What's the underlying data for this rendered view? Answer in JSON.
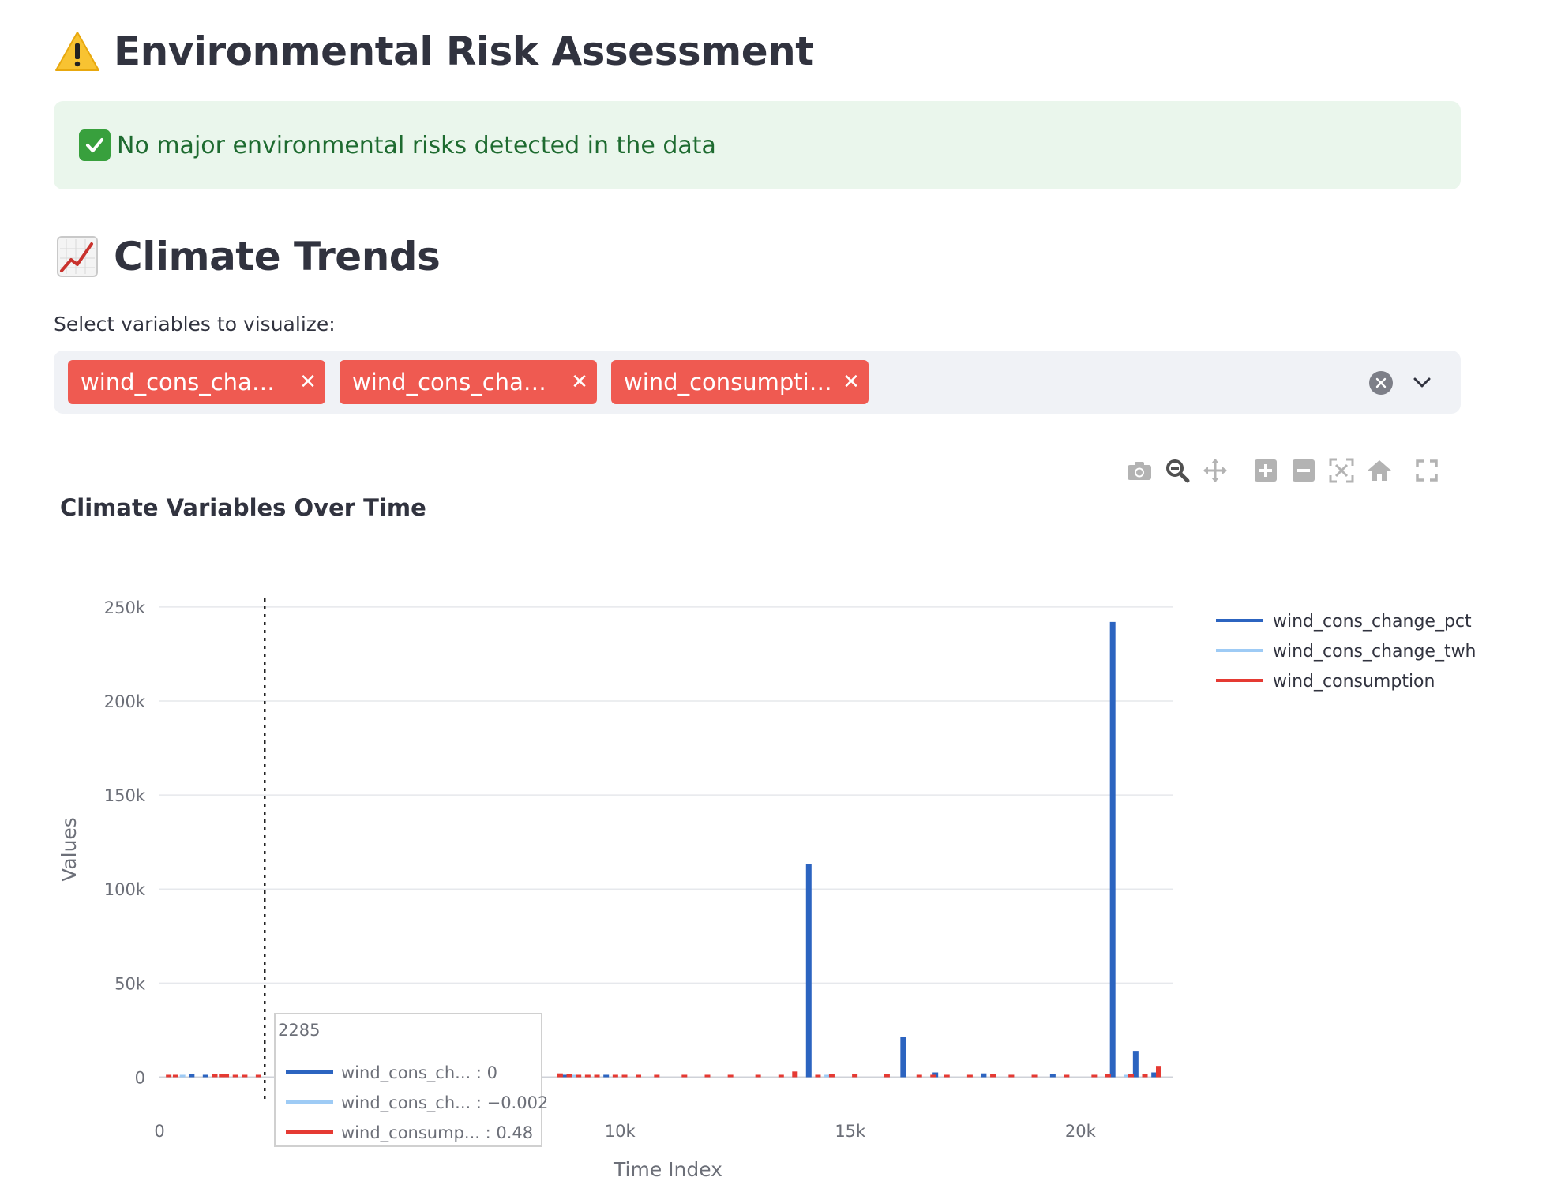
{
  "risk": {
    "heading": "Environmental Risk Assessment",
    "heading_icon": "warning-icon",
    "alert_icon": "check-icon",
    "alert_text": "No major environmental risks detected in the data",
    "alert_color": "#eaf6ec"
  },
  "trends": {
    "heading": "Climate Trends",
    "heading_icon": "chart-increasing-icon",
    "select_label": "Select variables to visualize:",
    "selected": [
      "wind_cons_cha…",
      "wind_cons_cha…",
      "wind_consumpti…"
    ],
    "tag_color": "#ef5a51"
  },
  "modebar": [
    "camera-icon",
    "zoom-icon",
    "pan-icon",
    "zoom-in-icon",
    "zoom-out-icon",
    "autoscale-icon",
    "reset-axes-icon",
    "fullscreen-icon"
  ],
  "hover": {
    "x": "2285",
    "rows": [
      {
        "label": "wind_cons_ch... : 0",
        "color": "#2c64c0"
      },
      {
        "label": "wind_cons_ch... : −0.002",
        "color": "#9ecbf5"
      },
      {
        "label": "wind_consump... : 0.48",
        "color": "#e53a33"
      }
    ]
  },
  "chart_data": {
    "type": "bar",
    "title": "Climate Variables Over Time",
    "xlabel": "Time Index",
    "ylabel": "Values",
    "xlim": [
      0,
      22000
    ],
    "ylim": [
      -4000,
      260000
    ],
    "xticks": [
      0,
      10000,
      15000,
      20000
    ],
    "xtick_labels": [
      "0",
      "10k",
      "15k",
      "20k"
    ],
    "yticks": [
      0,
      50000,
      100000,
      150000,
      200000,
      250000
    ],
    "ytick_labels": [
      "0",
      "50k",
      "100k",
      "150k",
      "200k",
      "250k"
    ],
    "grid": true,
    "legend_position": "top-right",
    "hover_x": 2285,
    "series": [
      {
        "name": "wind_cons_change_pct",
        "color": "#2c64c0",
        "points": [
          [
            700,
            1500
          ],
          [
            1000,
            1200
          ],
          [
            8800,
            1000
          ],
          [
            9700,
            700
          ],
          [
            14100,
            113500
          ],
          [
            16150,
            21500
          ],
          [
            16850,
            2500
          ],
          [
            17900,
            2000
          ],
          [
            19400,
            1500
          ],
          [
            20700,
            242000
          ],
          [
            21200,
            14000
          ],
          [
            21600,
            2500
          ]
        ]
      },
      {
        "name": "wind_cons_change_twh",
        "color": "#9ecbf5",
        "points": [
          [
            500,
            200
          ],
          [
            9000,
            200
          ],
          [
            14500,
            200
          ],
          [
            18500,
            200
          ],
          [
            21000,
            200
          ]
        ]
      },
      {
        "name": "wind_consumption",
        "color": "#e53a33",
        "points": [
          [
            200,
            1000
          ],
          [
            350,
            1000
          ],
          [
            1200,
            1500
          ],
          [
            1350,
            1800
          ],
          [
            1450,
            1700
          ],
          [
            1650,
            900
          ],
          [
            1850,
            700
          ],
          [
            2150,
            500
          ],
          [
            8700,
            2000
          ],
          [
            8900,
            1500
          ],
          [
            9100,
            1000
          ],
          [
            9300,
            800
          ],
          [
            9500,
            700
          ],
          [
            9900,
            900
          ],
          [
            10100,
            900
          ],
          [
            10400,
            1000
          ],
          [
            10800,
            700
          ],
          [
            11400,
            1000
          ],
          [
            11900,
            1000
          ],
          [
            12400,
            800
          ],
          [
            13000,
            1000
          ],
          [
            13500,
            1200
          ],
          [
            13800,
            3000
          ],
          [
            14300,
            1000
          ],
          [
            14600,
            1500
          ],
          [
            15100,
            1500
          ],
          [
            15800,
            1500
          ],
          [
            16500,
            1000
          ],
          [
            16800,
            1000
          ],
          [
            17100,
            1200
          ],
          [
            17600,
            1000
          ],
          [
            18100,
            1500
          ],
          [
            18500,
            1000
          ],
          [
            19000,
            1200
          ],
          [
            19700,
            1000
          ],
          [
            20300,
            1000
          ],
          [
            20600,
            1500
          ],
          [
            21100,
            1500
          ],
          [
            21400,
            1500
          ],
          [
            21700,
            6000
          ]
        ]
      }
    ]
  }
}
